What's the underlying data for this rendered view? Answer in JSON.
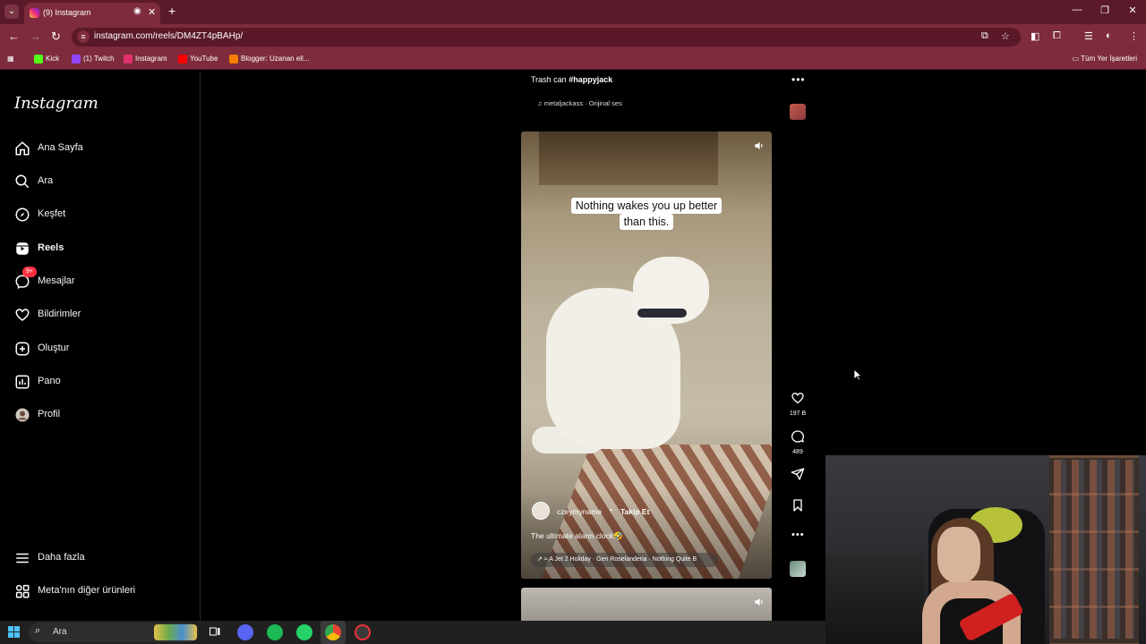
{
  "browser": {
    "tab_title": "(9) Instagram",
    "url": "instagram.com/reels/DM4ZT4pBAHp/",
    "bookmarks": [
      {
        "label": "Kick",
        "color": "#53fc18"
      },
      {
        "label": "(1) Twitch",
        "color": "#9146ff"
      },
      {
        "label": "Instagram",
        "color": "#e1306c"
      },
      {
        "label": "YouTube",
        "color": "#ff0000"
      },
      {
        "label": "Blogger: Uzanan ell...",
        "color": "#f57d00"
      }
    ],
    "all_bookmarks": "Tüm Yer İşaretleri"
  },
  "sidebar": {
    "logo": "Instagram",
    "items": [
      {
        "label": "Ana Sayfa",
        "icon": "home-icon"
      },
      {
        "label": "Ara",
        "icon": "search-icon"
      },
      {
        "label": "Keşfet",
        "icon": "compass-icon"
      },
      {
        "label": "Reels",
        "icon": "reels-icon"
      },
      {
        "label": "Mesajlar",
        "icon": "messenger-icon",
        "badge": "9+"
      },
      {
        "label": "Bildirimler",
        "icon": "heart-icon"
      },
      {
        "label": "Oluştur",
        "icon": "plus-square-icon"
      },
      {
        "label": "Pano",
        "icon": "chart-icon"
      },
      {
        "label": "Profil",
        "icon": "avatar"
      }
    ],
    "more": "Daha fazla",
    "meta": "Meta'nın diğer ürünleri"
  },
  "reel": {
    "header_title_prefix": "Trash can ",
    "header_hashtag": "#happyjack",
    "audio_line": "metaljackass · Orijinal ses",
    "caption_overlay_line1": "Nothing wakes you up better",
    "caption_overlay_line2": "than this.",
    "author": "czeymyname",
    "follow": "Takip Et",
    "caption": "The ultimate alarm clock🤣",
    "audio_pill": "↗ ≈ A Jet 2 Holiday · Gen Roselanderia · Nothing Quite B",
    "likes": "197 B",
    "comments": "489"
  },
  "taskbar": {
    "search_label": "Ara"
  },
  "colors": {
    "accent_badge": "#ff3040",
    "chrome_bg": "#7d2b3d"
  }
}
